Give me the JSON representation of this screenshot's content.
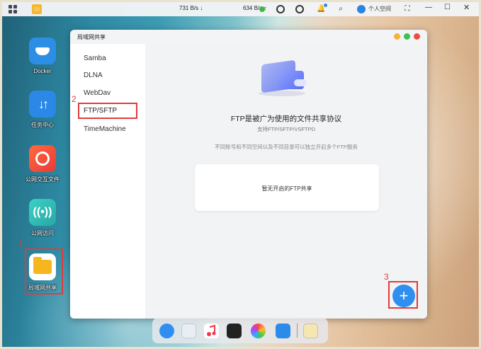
{
  "topbar": {
    "speed_down": "731 B/s",
    "speed_up": "634 B/s",
    "user_label": "个人空间",
    "bell_badge": "•"
  },
  "desktop": {
    "icons": [
      {
        "label": "Docker"
      },
      {
        "label": "任务中心"
      },
      {
        "label": "公网交互文件"
      },
      {
        "label": "公网访问"
      },
      {
        "label": "局域网共享"
      }
    ]
  },
  "window": {
    "title": "局域网共享",
    "sidebar": [
      "Samba",
      "DLNA",
      "WebDav",
      "FTP/SFTP",
      "TimeMachine"
    ],
    "selected_index": 3,
    "content": {
      "title": "FTP是被广为使用的文件共享协议",
      "subtitle": "支持FTP/SFTP/VSFTPD",
      "description": "不同账号和不同空间以及不同目录可以独立开启多个FTP服务",
      "empty_text": "暂无开启的FTP共享"
    },
    "fab_label": "+"
  },
  "annotations": [
    "1",
    "2",
    "3"
  ],
  "colors": {
    "accent": "#2f8ff0",
    "highlight": "#e23b3b",
    "dot_yellow": "#f4b23a",
    "dot_green": "#3cc14d",
    "dot_red": "#f04a43"
  },
  "dock": {
    "items": [
      "apps-icon",
      "recycle-icon",
      "music-icon",
      "video-icon",
      "photos-icon",
      "files-icon",
      "notes-icon"
    ]
  }
}
